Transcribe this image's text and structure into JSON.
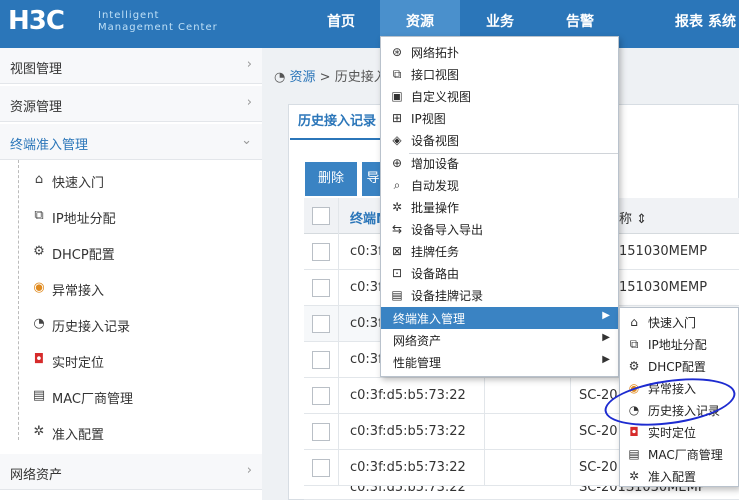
{
  "header": {
    "logo": "H3C",
    "logo_sub_1": "Intelligent",
    "logo_sub_2": "Management Center",
    "nav": [
      "首页",
      "资源",
      "业务",
      "告警",
      "报表",
      "系统"
    ]
  },
  "sidebar": {
    "groups": [
      "视图管理",
      "资源管理",
      "终端准入管理",
      "网络资产"
    ],
    "items": [
      {
        "label": "快速入门",
        "icon": "home-icon"
      },
      {
        "label": "IP地址分配",
        "icon": "ip-icon"
      },
      {
        "label": "DHCP配置",
        "icon": "gear-icon"
      },
      {
        "label": "异常接入",
        "icon": "warning-icon"
      },
      {
        "label": "历史接入记录",
        "icon": "history-icon"
      },
      {
        "label": "实时定位",
        "icon": "location-icon"
      },
      {
        "label": "MAC厂商管理",
        "icon": "device-icon"
      },
      {
        "label": "准入配置",
        "icon": "config-icon"
      }
    ]
  },
  "breadcrumb": {
    "link": "资源",
    "sep": ">",
    "current": "历史接入"
  },
  "tab": {
    "label": "历史接入记录"
  },
  "toolbar": {
    "delete_label": "删除",
    "second_label": "导"
  },
  "table": {
    "headers": [
      "终端MAC",
      "称 ⇕"
    ],
    "rows": [
      {
        "mac": "c0:3f",
        "name": "151030MEMP"
      },
      {
        "mac": "c0:3f",
        "name": "151030MEMP"
      },
      {
        "mac": "c0:3f",
        "name": ""
      },
      {
        "mac": "c0:3f",
        "name": ""
      },
      {
        "mac": "c0:3f:d5:b5:73:22",
        "name": "SC-20"
      },
      {
        "mac": "c0:3f:d5:b5:73:22",
        "name": "SC-20"
      },
      {
        "mac": "c0:3f:d5:b5:73:22",
        "name": "SC-20"
      },
      {
        "mac": "c0:3f:d5:b5:73:22",
        "name": "SC-201S1030MEMP"
      }
    ]
  },
  "menu": {
    "items": [
      "网络拓扑",
      "接口视图",
      "自定义视图",
      "IP视图",
      "设备视图",
      "增加设备",
      "自动发现",
      "批量操作",
      "设备导入导出",
      "挂牌任务",
      "设备路由",
      "设备挂牌记录",
      "终端准入管理",
      "网络资产",
      "性能管理"
    ],
    "arrow": "▶"
  },
  "submenu": {
    "items": [
      "快速入门",
      "IP地址分配",
      "DHCP配置",
      "异常接入",
      "历史接入记录",
      "实时定位",
      "MAC厂商管理",
      "准入配置"
    ]
  },
  "colors": {
    "brand": "#2b76b9",
    "annotation": "#1d2bd0"
  }
}
